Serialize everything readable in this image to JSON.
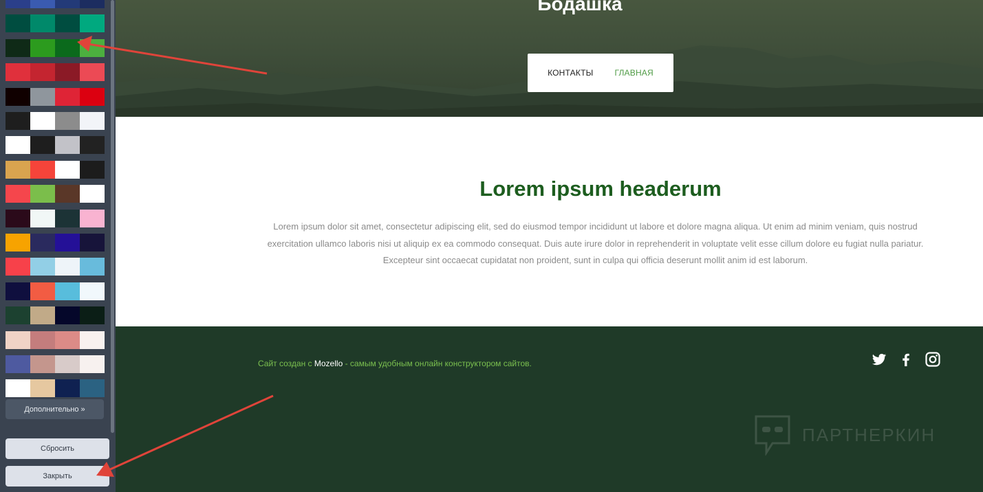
{
  "palette_rows": [
    [
      "#2b3f8a",
      "#3a5bb0",
      "#233a78",
      "#1c2d60"
    ],
    [
      "#004d40",
      "#00896a",
      "#004d40",
      "#00a97f"
    ],
    [
      "#0f2a17",
      "#2c9b1e",
      "#0b6a1c",
      "#4caf3f"
    ],
    [
      "#e0303c",
      "#c42530",
      "#8b1a26",
      "#ec4a55"
    ],
    [
      "#100000",
      "#8f969d",
      "#df2436",
      "#dc0010"
    ],
    [
      "#1e1e1e",
      "#ffffff",
      "#8c8c8c",
      "#f2f4f8"
    ],
    [
      "#ffffff",
      "#1e1e1e",
      "#c2c2c8",
      "#222222"
    ],
    [
      "#d9a44f",
      "#f5443a",
      "#ffffff",
      "#1c1c1c"
    ],
    [
      "#f5464c",
      "#7bbe4b",
      "#5a3728",
      "#ffffff"
    ],
    [
      "#2b0a1a",
      "#f1f7f6",
      "#1c3336",
      "#f9b3d1"
    ],
    [
      "#f7a300",
      "#2a2a5e",
      "#241097",
      "#17143a"
    ],
    [
      "#f7414a",
      "#92cfe6",
      "#eef4f9",
      "#68bbdc"
    ],
    [
      "#0f0f3e",
      "#f25c43",
      "#58bddc",
      "#f1f8fc"
    ],
    [
      "#1c4130",
      "#c1aa88",
      "#05072a",
      "#0b1e16"
    ],
    [
      "#f0d3c6",
      "#c47d7d",
      "#dc8b87",
      "#f8f1ef"
    ],
    [
      "#4e5aa0",
      "#c4968d",
      "#d8cbc9",
      "#f7f1ef"
    ],
    [
      "#ffffff",
      "#e6c8a0",
      "#0f2151",
      "#2b6282"
    ]
  ],
  "panel": {
    "more_label": "Дополнительно »",
    "reset_label": "Сбросить",
    "close_label": "Закрыть"
  },
  "hero": {
    "title": "Бодашка",
    "nav": {
      "contacts": "КОНТАКТЫ",
      "home": "ГЛАВНАЯ"
    }
  },
  "content": {
    "heading": "Lorem ipsum headerum",
    "body": "Lorem ipsum dolor sit amet, consectetur adipiscing elit, sed do eiusmod tempor incididunt ut labore et dolore magna aliqua. Ut enim ad minim veniam, quis nostrud exercitation ullamco laboris nisi ut aliquip ex ea commodo consequat. Duis aute irure dolor in reprehenderit in voluptate velit esse cillum dolore eu fugiat nulla pariatur. Excepteur sint occaecat cupidatat non proident, sunt in culpa qui officia deserunt mollit anim id est laborum."
  },
  "footer": {
    "prefix": "Сайт создан с ",
    "brand": "Mozello",
    "suffix": " - самым удобным онлайн конструктором сайтов.",
    "social_icons": [
      "twitter-icon",
      "facebook-icon",
      "instagram-icon"
    ]
  },
  "watermark": {
    "text": "ПАРТНЕРКИН"
  },
  "colors": {
    "panel_bg": "#3a4350",
    "footer_bg": "#1f3a28",
    "heading": "#1d5d1f",
    "nav_active": "#4f9b45",
    "footer_text": "#7bc04f",
    "arrow": "#e0443a"
  }
}
